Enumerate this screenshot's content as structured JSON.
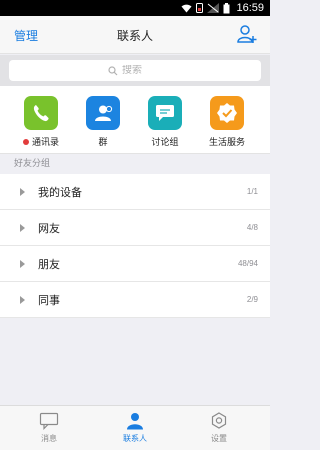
{
  "status_bar": {
    "time": "16:59"
  },
  "nav": {
    "left_label": "管理",
    "title": "联系人"
  },
  "search": {
    "placeholder": "搜索"
  },
  "apps": [
    {
      "label": "通讯录",
      "icon": "phone-icon",
      "color": "#79c22c",
      "has_dot": true
    },
    {
      "label": "群",
      "icon": "group-icon",
      "color": "#1c84e0"
    },
    {
      "label": "讨论组",
      "icon": "chat-bubble-icon",
      "color": "#1aaeb8"
    },
    {
      "label": "生活服务",
      "icon": "badge-check-icon",
      "color": "#f59a1b"
    }
  ],
  "section": {
    "title": "好友分组"
  },
  "groups": [
    {
      "name": "我的设备",
      "count": "1/1"
    },
    {
      "name": "网友",
      "count": "4/8"
    },
    {
      "name": "朋友",
      "count": "48/94"
    },
    {
      "name": "同事",
      "count": "2/9"
    }
  ],
  "tabs": [
    {
      "label": "消息",
      "icon": "message-icon",
      "active": false
    },
    {
      "label": "联系人",
      "icon": "contact-icon",
      "active": true
    },
    {
      "label": "设置",
      "icon": "settings-icon",
      "active": false
    }
  ],
  "colors": {
    "accent": "#1a7de0",
    "notification_dot": "#e23c3c"
  }
}
